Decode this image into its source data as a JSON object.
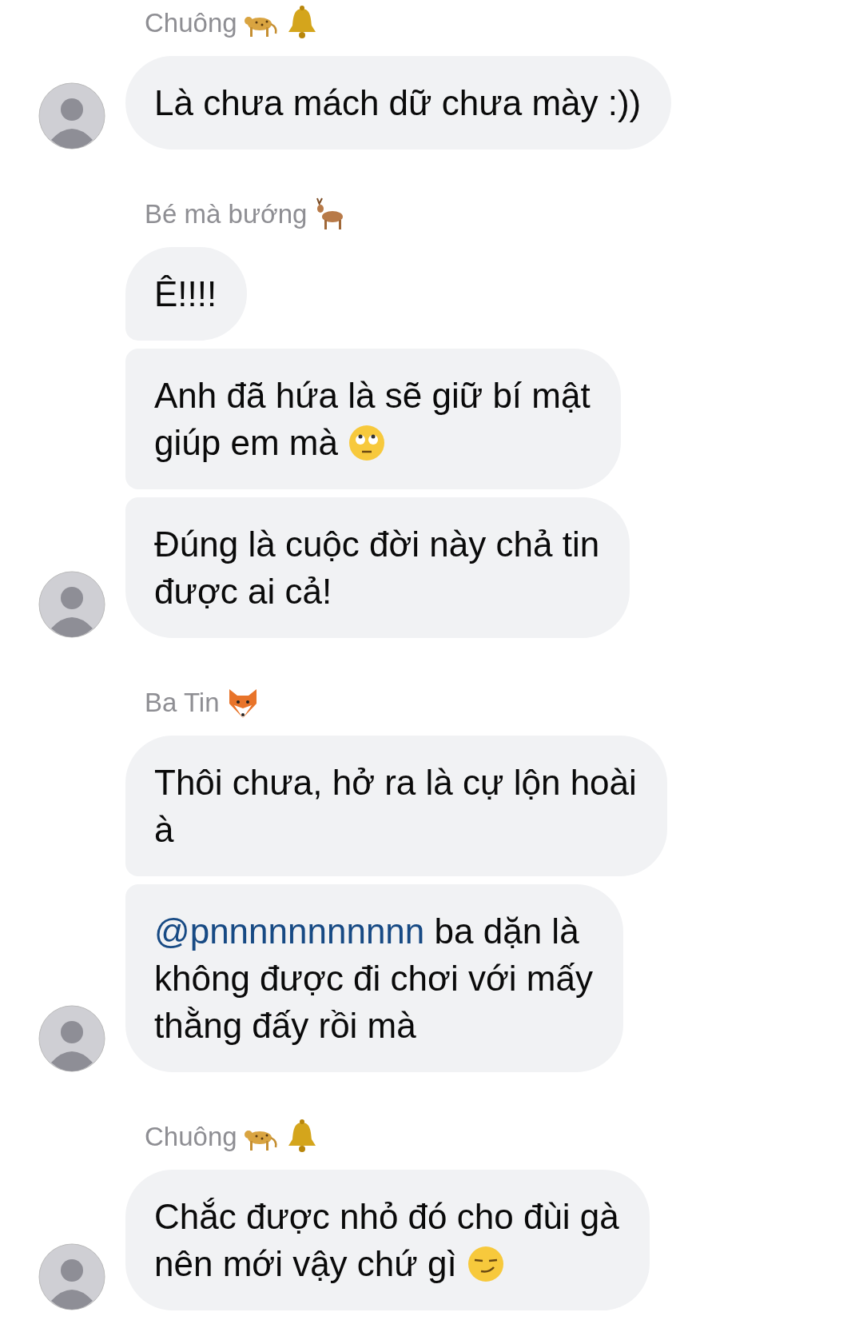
{
  "groups": [
    {
      "sender": {
        "name": "Chuông",
        "icons": [
          {
            "kind": "leopard"
          },
          {
            "kind": "bell"
          }
        ]
      },
      "messages": [
        {
          "parts": [
            {
              "kind": "text",
              "text": "Là chưa mách dữ chưa mày :))"
            }
          ]
        }
      ]
    },
    {
      "sender": {
        "name": "Bé mà bướng",
        "icons": [
          {
            "kind": "deer"
          }
        ]
      },
      "messages": [
        {
          "parts": [
            {
              "kind": "text",
              "text": "Ê!!!!"
            }
          ]
        },
        {
          "parts": [
            {
              "kind": "text",
              "text": "Anh đã hứa là sẽ giữ bí mật\ngiúp em mà "
            },
            {
              "kind": "eyeroll"
            }
          ]
        },
        {
          "parts": [
            {
              "kind": "text",
              "text": "Đúng là cuộc đời này chả tin\nđược ai cả!"
            }
          ]
        }
      ]
    },
    {
      "sender": {
        "name": "Ba Tin",
        "icons": [
          {
            "kind": "fox"
          }
        ]
      },
      "messages": [
        {
          "parts": [
            {
              "kind": "text",
              "text": "Thôi chưa, hở ra là cự lộn hoài\nà"
            }
          ]
        },
        {
          "parts": [
            {
              "kind": "mention",
              "text": "@pnnnnnnnnnnn"
            },
            {
              "kind": "text",
              "text": " ba dặn là\nkhông được đi chơi với mấy\nthằng đấy rồi mà"
            }
          ]
        }
      ]
    },
    {
      "sender": {
        "name": "Chuông",
        "icons": [
          {
            "kind": "leopard"
          },
          {
            "kind": "bell"
          }
        ]
      },
      "messages": [
        {
          "parts": [
            {
              "kind": "text",
              "text": "Chắc được nhỏ đó cho đùi gà\nnên mới vậy chứ gì "
            },
            {
              "kind": "smirk"
            }
          ]
        }
      ]
    }
  ]
}
